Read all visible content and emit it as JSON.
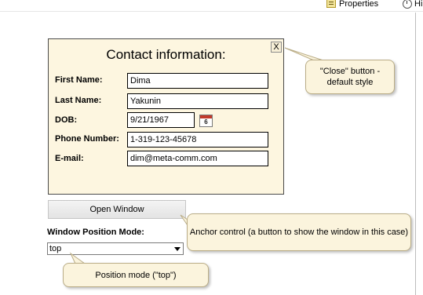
{
  "toolbar": {
    "properties_label": "Properties",
    "history_label": "Hi",
    "properties_icon": "properties-icon",
    "history_icon": "history-clock-icon"
  },
  "window": {
    "title": "Contact information:",
    "close_label": "X",
    "fields": {
      "first_name": {
        "label": "First Name:",
        "value": "Dima"
      },
      "last_name": {
        "label": "Last Name:",
        "value": "Yakunin"
      },
      "dob": {
        "label": "DOB:",
        "value": "9/21/1967",
        "calendar_day": "6"
      },
      "phone": {
        "label": "Phone Number:",
        "value": "1-319-123-45678"
      },
      "email": {
        "label": "E-mail:",
        "value": "dim@meta-comm.com"
      }
    }
  },
  "controls": {
    "open_window_label": "Open Window",
    "position_mode_label": "Window Position Mode:",
    "position_mode_selected": "top"
  },
  "callouts": {
    "close": "\"Close\" button - default style",
    "anchor": "Anchor control (a button to show the window in this case)",
    "mode": "Position mode (\"top\")"
  },
  "colors": {
    "window_bg": "#fdf6e0",
    "callout_bg": "#fbf4dd",
    "callout_border": "#b9ac86"
  }
}
